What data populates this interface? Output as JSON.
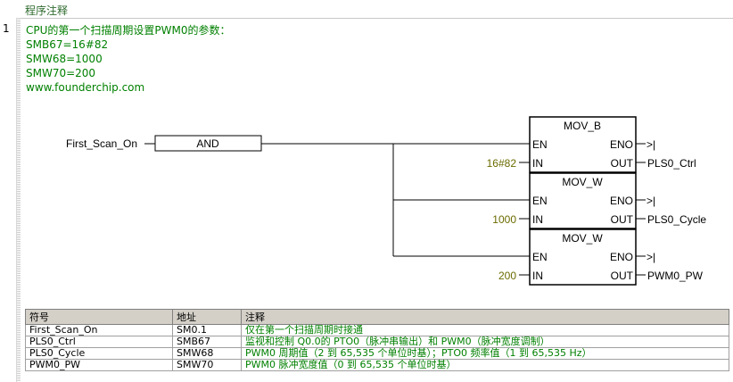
{
  "header": {
    "title": "程序注释"
  },
  "network": {
    "number": "1",
    "comment_lines": [
      "CPU的第一个扫描周期设置PWM0的参数：",
      "SMB67=16#82",
      "SMW68=1000",
      "SMW70=200",
      "www.founderchip.com"
    ]
  },
  "ladder": {
    "input_contact": "First_Scan_On",
    "logic_box": "AND",
    "boxes": [
      {
        "title": "MOV_B",
        "en": "EN",
        "eno": "ENO",
        "in_label": "IN",
        "out_label": "OUT",
        "in_value": "16#82",
        "out_value": "PLS0_Ctrl",
        "eno_coil": ">|"
      },
      {
        "title": "MOV_W",
        "en": "EN",
        "eno": "ENO",
        "in_label": "IN",
        "out_label": "OUT",
        "in_value": "1000",
        "out_value": "PLS0_Cycle",
        "eno_coil": ">|"
      },
      {
        "title": "MOV_W",
        "en": "EN",
        "eno": "ENO",
        "in_label": "IN",
        "out_label": "OUT",
        "in_value": "200",
        "out_value": "PWM0_PW",
        "eno_coil": ">|"
      }
    ]
  },
  "symbol_table": {
    "headers": [
      "符号",
      "地址",
      "注释"
    ],
    "rows": [
      [
        "First_Scan_On",
        "SM0.1",
        "仅在第一个扫描周期时接通"
      ],
      [
        "PLS0_Ctrl",
        "SMB67",
        "监视和控制 Q0.0的 PTO0（脉冲串输出）和 PWM0（脉冲宽度调制）"
      ],
      [
        "PLS0_Cycle",
        "SMW68",
        "PWM0 周期值（2 到 65,535 个单位时基）；PTO0 频率值（1 到 65,535 Hz）"
      ],
      [
        "PWM0_PW",
        "SMW70",
        "PWM0 脉冲宽度值（0 到 65,535 个单位时基）"
      ]
    ]
  },
  "colors": {
    "comment": "#008000",
    "operand": "#6b6b00",
    "line": "#000000",
    "header_bg": "#d4d0c8"
  }
}
